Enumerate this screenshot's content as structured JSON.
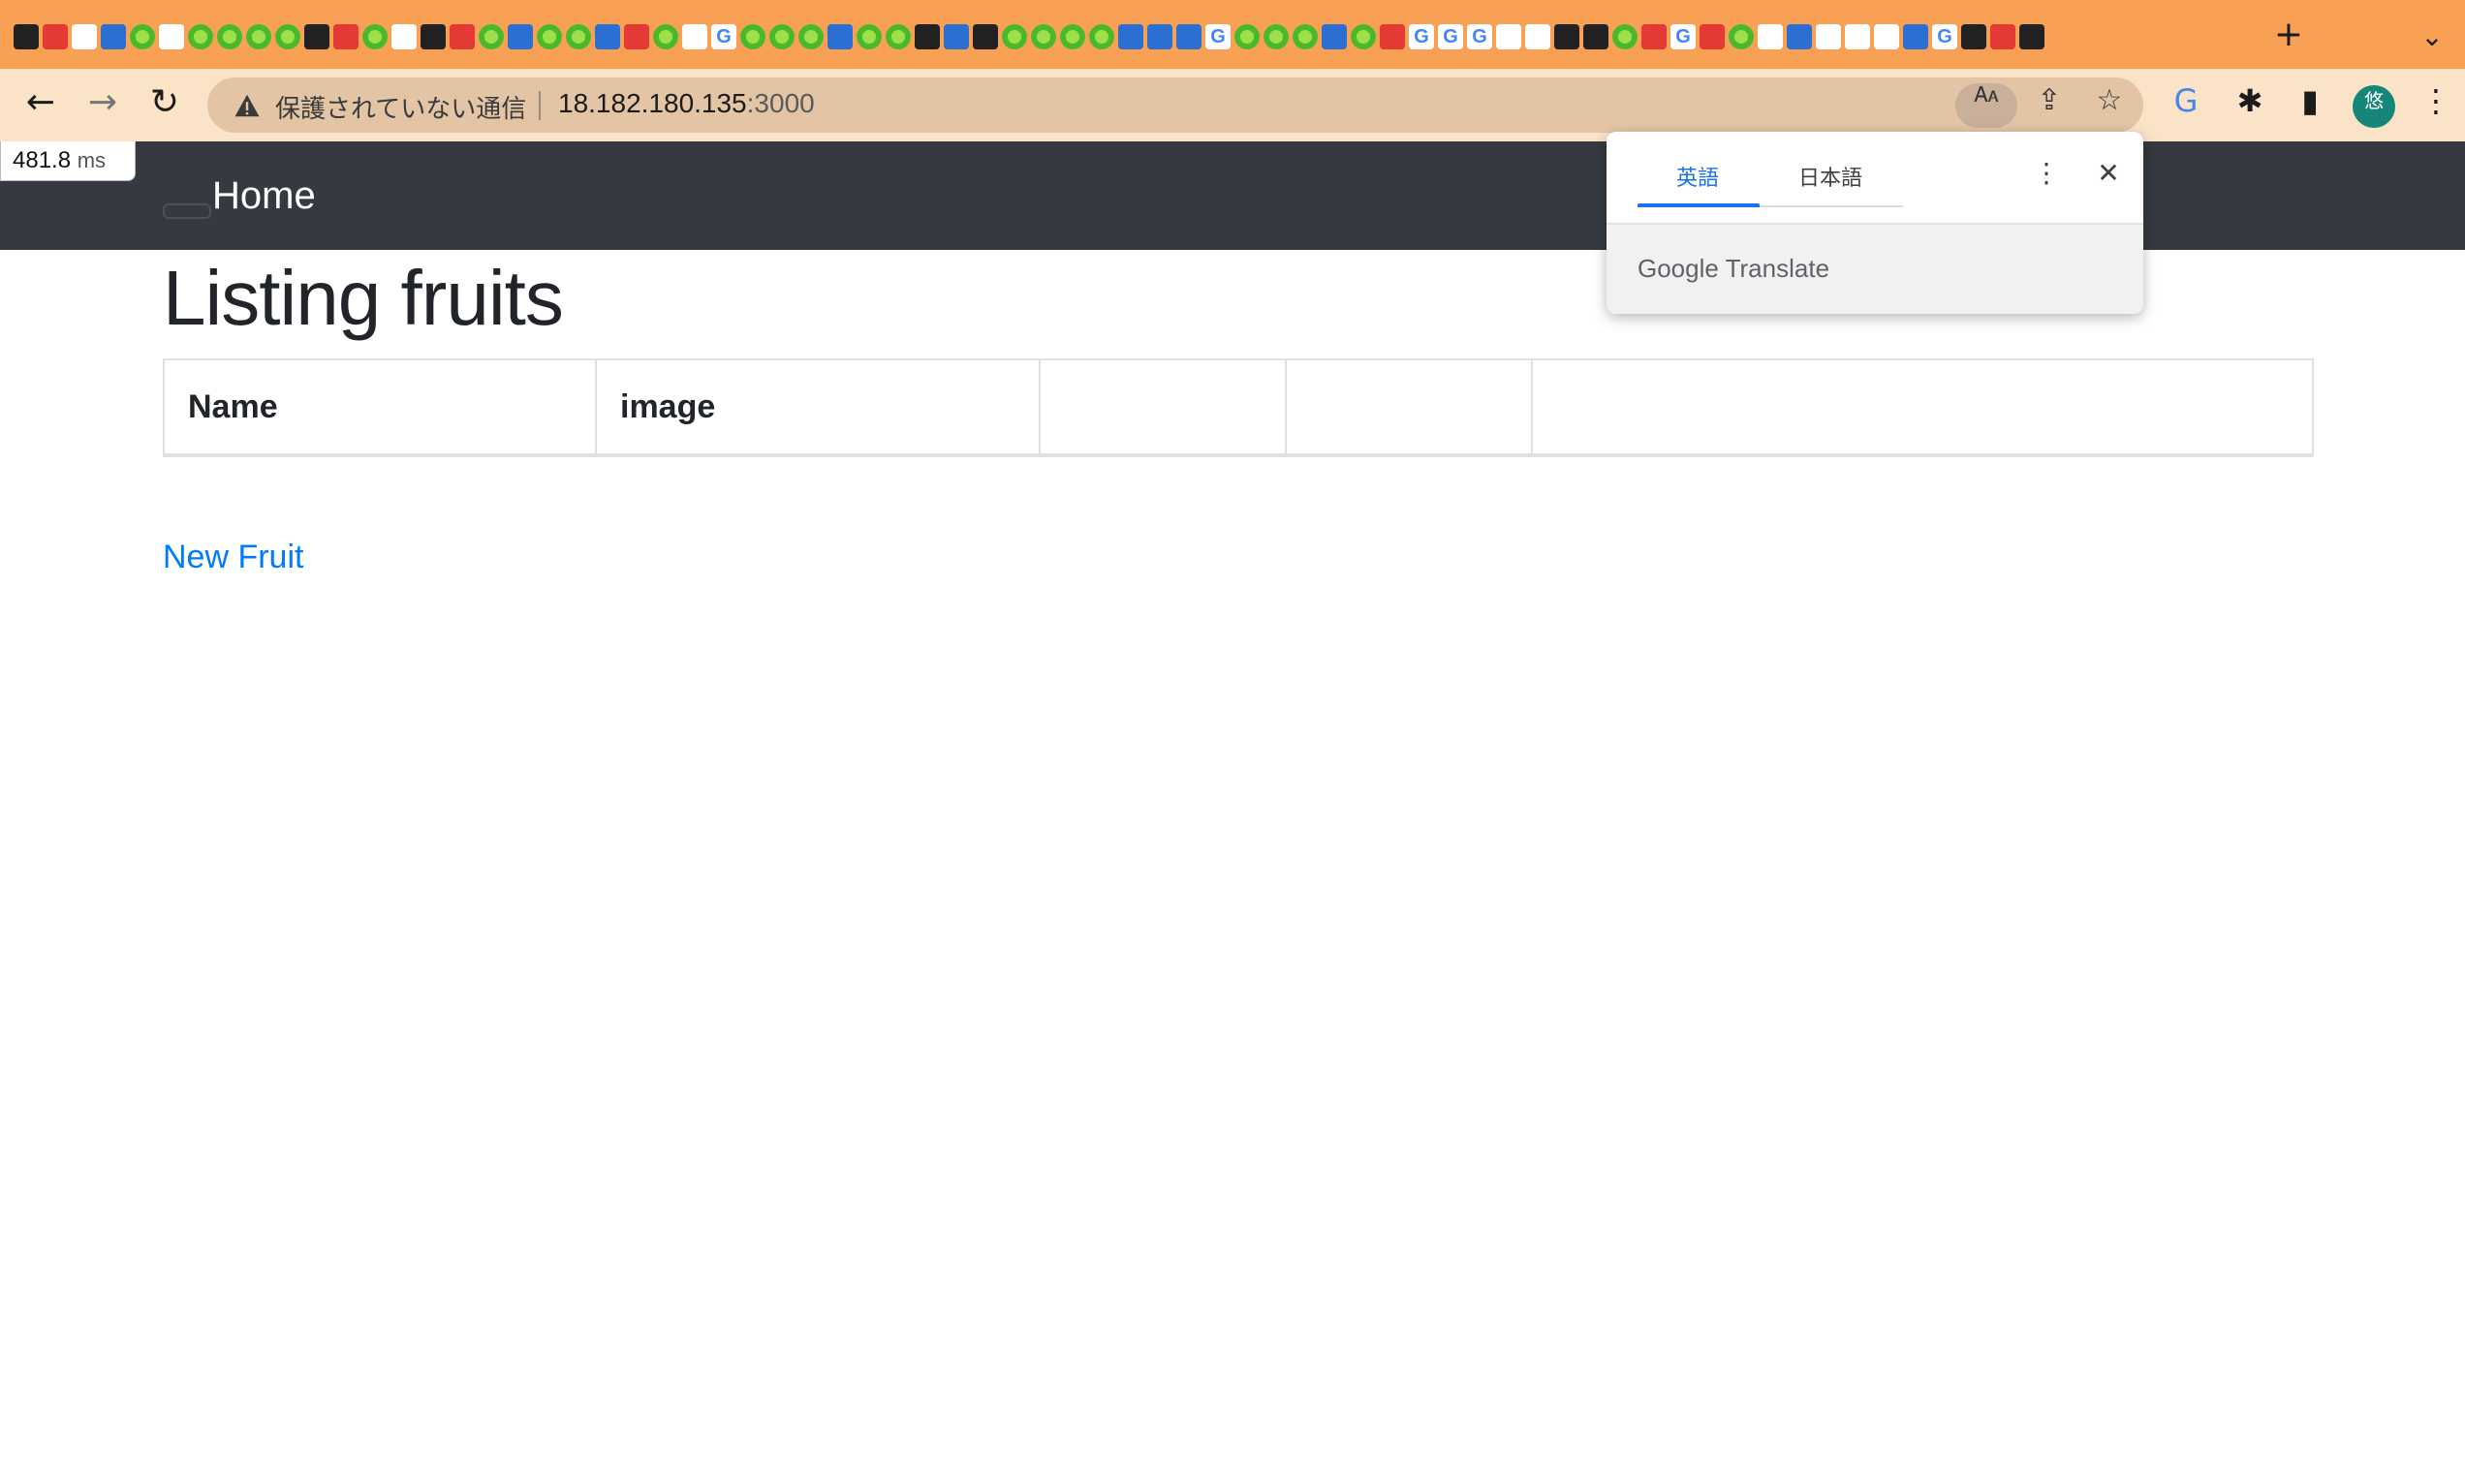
{
  "browser": {
    "address_bar": {
      "security_label": "保護されていない通信",
      "url_host": "18.182.180.135",
      "url_port": ":3000"
    },
    "profile_initial": "悠",
    "tab_favicon_count": 70
  },
  "page": {
    "timing_value": "481.8",
    "timing_unit": "ms",
    "navbar": {
      "brand": "Home"
    },
    "title": "Listing fruits",
    "table": {
      "headers": [
        "Name",
        "image",
        "",
        "",
        ""
      ]
    },
    "new_link": "New Fruit"
  },
  "translate_popup": {
    "tabs": [
      "英語",
      "日本語"
    ],
    "active_tab": "英語",
    "footer_brand": "Google",
    "footer_product": "Translate"
  },
  "colors": {
    "tabstrip": "#f8a155",
    "toolbar": "#fbe3c8",
    "navbar": "#343a40",
    "link": "#007bff",
    "translate_active": "#1a73e8",
    "avatar": "#16867a"
  }
}
